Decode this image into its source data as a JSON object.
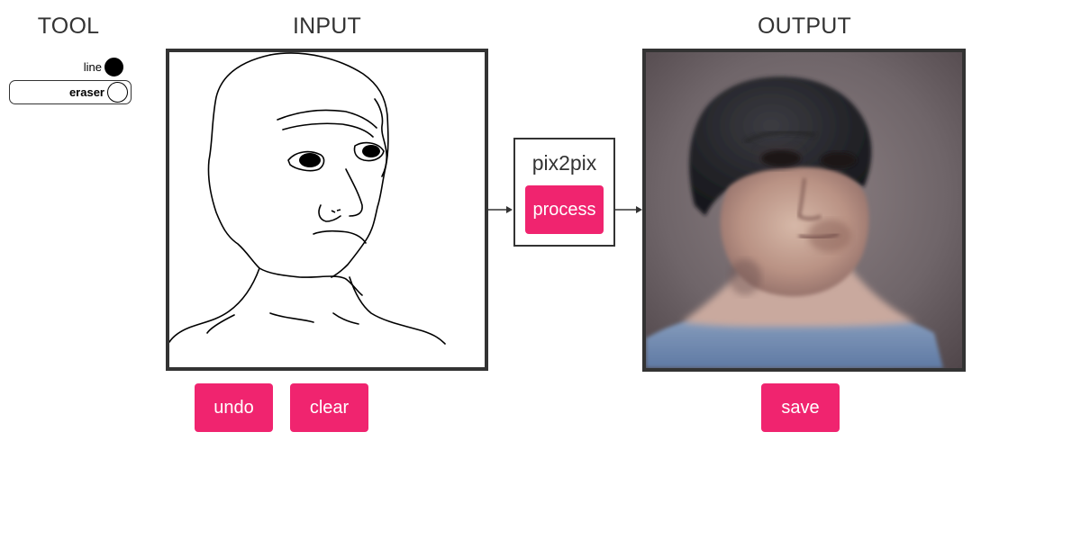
{
  "headings": {
    "tool": "TOOL",
    "input": "INPUT",
    "output": "OUTPUT"
  },
  "tools": [
    {
      "label": "line",
      "icon": "filled-circle-icon",
      "selected": true
    },
    {
      "label": "eraser",
      "icon": "empty-circle-icon",
      "selected": false
    }
  ],
  "process_box": {
    "model_name": "pix2pix",
    "button_label": "process"
  },
  "input_actions": {
    "undo_label": "undo",
    "clear_label": "clear"
  },
  "output_actions": {
    "save_label": "save"
  },
  "colors": {
    "accent": "#f0246f",
    "frame": "#333333",
    "text": "#333333",
    "background": "#ffffff"
  }
}
